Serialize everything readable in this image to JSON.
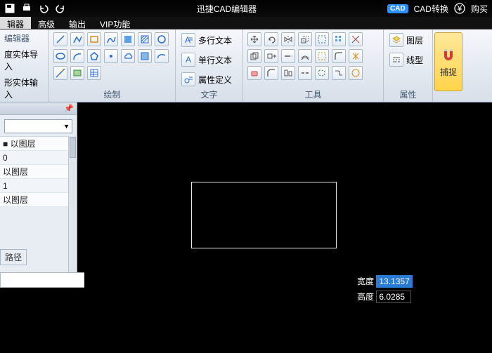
{
  "titlebar": {
    "title": "迅捷CAD编辑器",
    "right": {
      "cad_convert": "CAD转换",
      "buy": "购买"
    }
  },
  "menu": {
    "items": [
      "辑器",
      "高级",
      "输出",
      "VIP功能"
    ],
    "active_index": 0
  },
  "ribbon": {
    "groups": {
      "edit": {
        "title": "编辑器",
        "items": [
          "度实体导入",
          "形实体输入"
        ]
      },
      "draw": {
        "title": "绘制"
      },
      "text": {
        "title": "文字",
        "multi": "多行文本",
        "single": "单行文本",
        "attr": "属性定义"
      },
      "tools": {
        "title": "工具"
      },
      "prop": {
        "title": "属性",
        "layer": "图层",
        "line": "线型"
      },
      "snap": {
        "title": "捕捉"
      }
    }
  },
  "leftpanel": {
    "rows": [
      "■ 以图层",
      "0",
      "以图层",
      "1",
      "以图层"
    ],
    "footer_tab": "路径"
  },
  "dims": {
    "width_label": "宽度",
    "width_value": "13.1357",
    "height_label": "高度",
    "height_value": "6.0285"
  }
}
